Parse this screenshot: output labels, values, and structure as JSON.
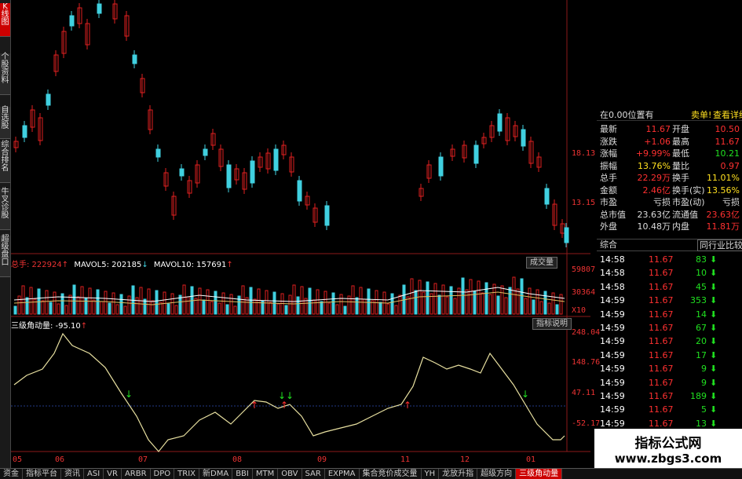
{
  "left_tabs": [
    "K线图",
    "个股资料",
    "自选股",
    "综合排名",
    "牛叉诊股",
    "超级盘口"
  ],
  "price_axis": [
    "18.13",
    "13.15"
  ],
  "vol_header": {
    "label": "总手: 222924",
    "ma5": "MAVOL5: 202185",
    "ma10": "MAVOL10: 157691"
  },
  "vol_axis": [
    "59807",
    "30364",
    "X10"
  ],
  "vol_button": "成交量",
  "ind_header": "三级角动量: -95.10",
  "ind_button": "指标说明",
  "ind_axis": [
    "248.04",
    "148.76",
    "47.11",
    "-52.17"
  ],
  "date_labels": [
    "05",
    "06",
    "07",
    "08",
    "09",
    "11",
    "12",
    "01"
  ],
  "right_header": {
    "title": "在0.00位置有",
    "sell": "卖单!",
    "detail": "查看详细"
  },
  "quote_rows": [
    {
      "l1": "最新",
      "v1": "11.67",
      "l2": "开盘",
      "v2": "10.50"
    },
    {
      "l1": "涨跌",
      "v1": "+1.06",
      "l2": "最高",
      "v2": "11.67"
    },
    {
      "l1": "涨幅",
      "v1": "+9.99%",
      "l2": "最低",
      "v2": "10.21"
    },
    {
      "l1": "振幅",
      "v1": "13.76%",
      "l2": "量比",
      "v2": "0.97"
    },
    {
      "l1": "总手",
      "v1": "22.29万",
      "l2": "换手",
      "v2": "11.01%"
    },
    {
      "l1": "金额",
      "v1": "2.46亿",
      "l2": "换手(实)",
      "v2": "13.56%"
    },
    {
      "l1": "市盈",
      "v1": "亏损",
      "l2": "市盈(动)",
      "v2": "亏损"
    },
    {
      "l1": "总市值",
      "v1": "23.63亿",
      "l2": "流通值",
      "v2": "23.63亿"
    },
    {
      "l1": "外盘",
      "v1": "10.48万",
      "l2": "内盘",
      "v2": "11.81万"
    }
  ],
  "right_tabs": [
    "综合",
    "同行业比较"
  ],
  "ticks": [
    {
      "t": "14:58",
      "p": "11.67",
      "v": "83"
    },
    {
      "t": "14:58",
      "p": "11.67",
      "v": "10"
    },
    {
      "t": "14:58",
      "p": "11.67",
      "v": "45"
    },
    {
      "t": "14:59",
      "p": "11.67",
      "v": "353"
    },
    {
      "t": "14:59",
      "p": "11.67",
      "v": "14"
    },
    {
      "t": "14:59",
      "p": "11.67",
      "v": "67"
    },
    {
      "t": "14:59",
      "p": "11.67",
      "v": "20"
    },
    {
      "t": "14:59",
      "p": "11.67",
      "v": "17"
    },
    {
      "t": "14:59",
      "p": "11.67",
      "v": "9"
    },
    {
      "t": "14:59",
      "p": "11.67",
      "v": "9"
    },
    {
      "t": "14:59",
      "p": "11.67",
      "v": "189"
    },
    {
      "t": "14:59",
      "p": "11.67",
      "v": "5"
    },
    {
      "t": "14:59",
      "p": "11.67",
      "v": "13"
    },
    {
      "t": "14:59",
      "p": "11.67",
      "v": "2"
    }
  ],
  "bottom_tabs": [
    "资金",
    "指标平台",
    "资讯",
    "ASI",
    "VR",
    "ARBR",
    "DPO",
    "TRIX",
    "新DMA",
    "BBI",
    "MTM",
    "OBV",
    "SAR",
    "EXPMA",
    "集合竞价成交量",
    "YH",
    "龙放升指",
    "超级方向",
    "三级角动量"
  ],
  "watermark": {
    "title": "指标公式网",
    "url": "www.zbgs3.com"
  },
  "colors": {
    "up": "#e02020",
    "down": "#40d0e0",
    "text_red": "#ff3030",
    "text_green": "#20e020",
    "text_yellow": "#ffe020"
  }
}
